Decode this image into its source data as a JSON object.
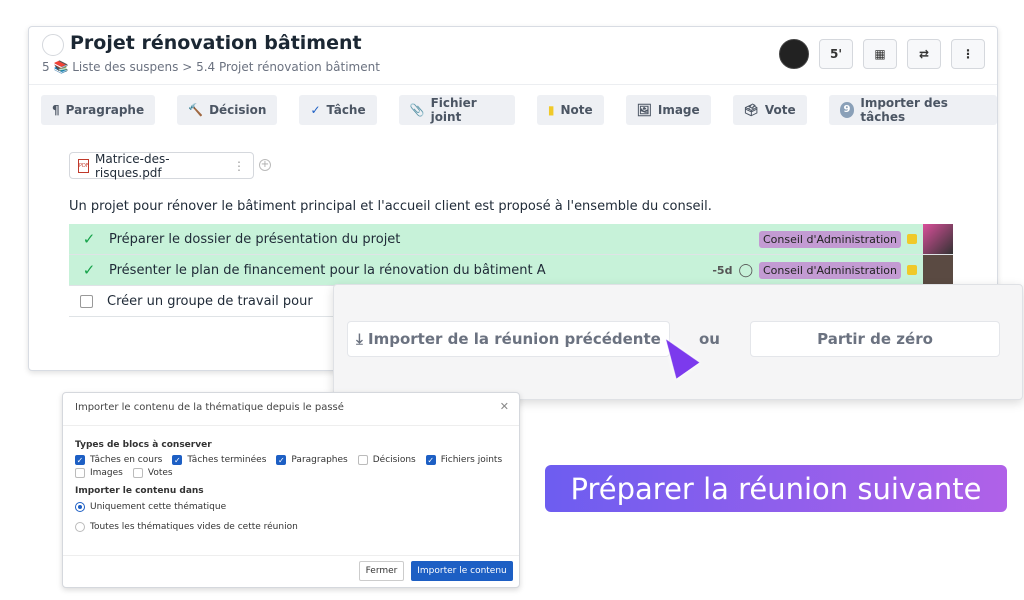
{
  "header": {
    "title": "Projet rénovation bâtiment",
    "breadcrumb": "5 📚 Liste des suspens > 5.4 Projet rénovation bâtiment",
    "duration": "5'"
  },
  "toolbar": [
    {
      "label": "Paragraphe",
      "icon": "¶"
    },
    {
      "label": "Décision",
      "icon": "🔨"
    },
    {
      "label": "Tâche",
      "icon": "✓"
    },
    {
      "label": "Fichier joint",
      "icon": "📎"
    },
    {
      "label": "Note",
      "icon": "▮"
    },
    {
      "label": "Image",
      "icon": "🖼"
    },
    {
      "label": "Vote",
      "icon": "🗳"
    },
    {
      "label": "Importer des tâches",
      "icon": "9"
    }
  ],
  "attachment": {
    "name": "Matrice-des-risques.pdf"
  },
  "description": "Un projet pour rénover le bâtiment principal et l'accueil client est proposé à l'ensemble du conseil.",
  "tasks": [
    {
      "label": "Préparer le dossier de présentation du projet",
      "done": true,
      "badge": "Conseil d'Administration",
      "due": ""
    },
    {
      "label": "Présenter le plan de financement pour la rénovation du bâtiment A",
      "done": true,
      "badge": "Conseil d'Administration",
      "due": "-5d"
    },
    {
      "label": "Créer un groupe de travail pour",
      "done": false,
      "badge": "",
      "due": ""
    }
  ],
  "import_panel": {
    "import_previous": "Importer de la réunion précédente",
    "or": "ou",
    "from_scratch": "Partir de zéro"
  },
  "dialog": {
    "title": "Importer le contenu de la thématique depuis le passé",
    "types_label": "Types de blocs à conserver",
    "types": [
      {
        "label": "Tâches en cours",
        "checked": true
      },
      {
        "label": "Tâches terminées",
        "checked": true
      },
      {
        "label": "Paragraphes",
        "checked": true
      },
      {
        "label": "Décisions",
        "checked": false
      },
      {
        "label": "Fichiers joints",
        "checked": true
      },
      {
        "label": "Images",
        "checked": false
      },
      {
        "label": "Votes",
        "checked": false
      }
    ],
    "target_label": "Importer le contenu dans",
    "targets": [
      {
        "label": "Uniquement cette thématique",
        "selected": true
      },
      {
        "label": "Toutes les thématiques vides de cette réunion",
        "selected": false
      }
    ],
    "close": "Fermer",
    "submit": "Importer le contenu"
  },
  "banner": "Préparer la réunion suivante",
  "colors": {
    "accent": "#1d5fc4",
    "done_row": "#c7f2d9",
    "badge": "#c39bd3",
    "banner_start": "#6d5df0",
    "banner_end": "#b061e8"
  }
}
